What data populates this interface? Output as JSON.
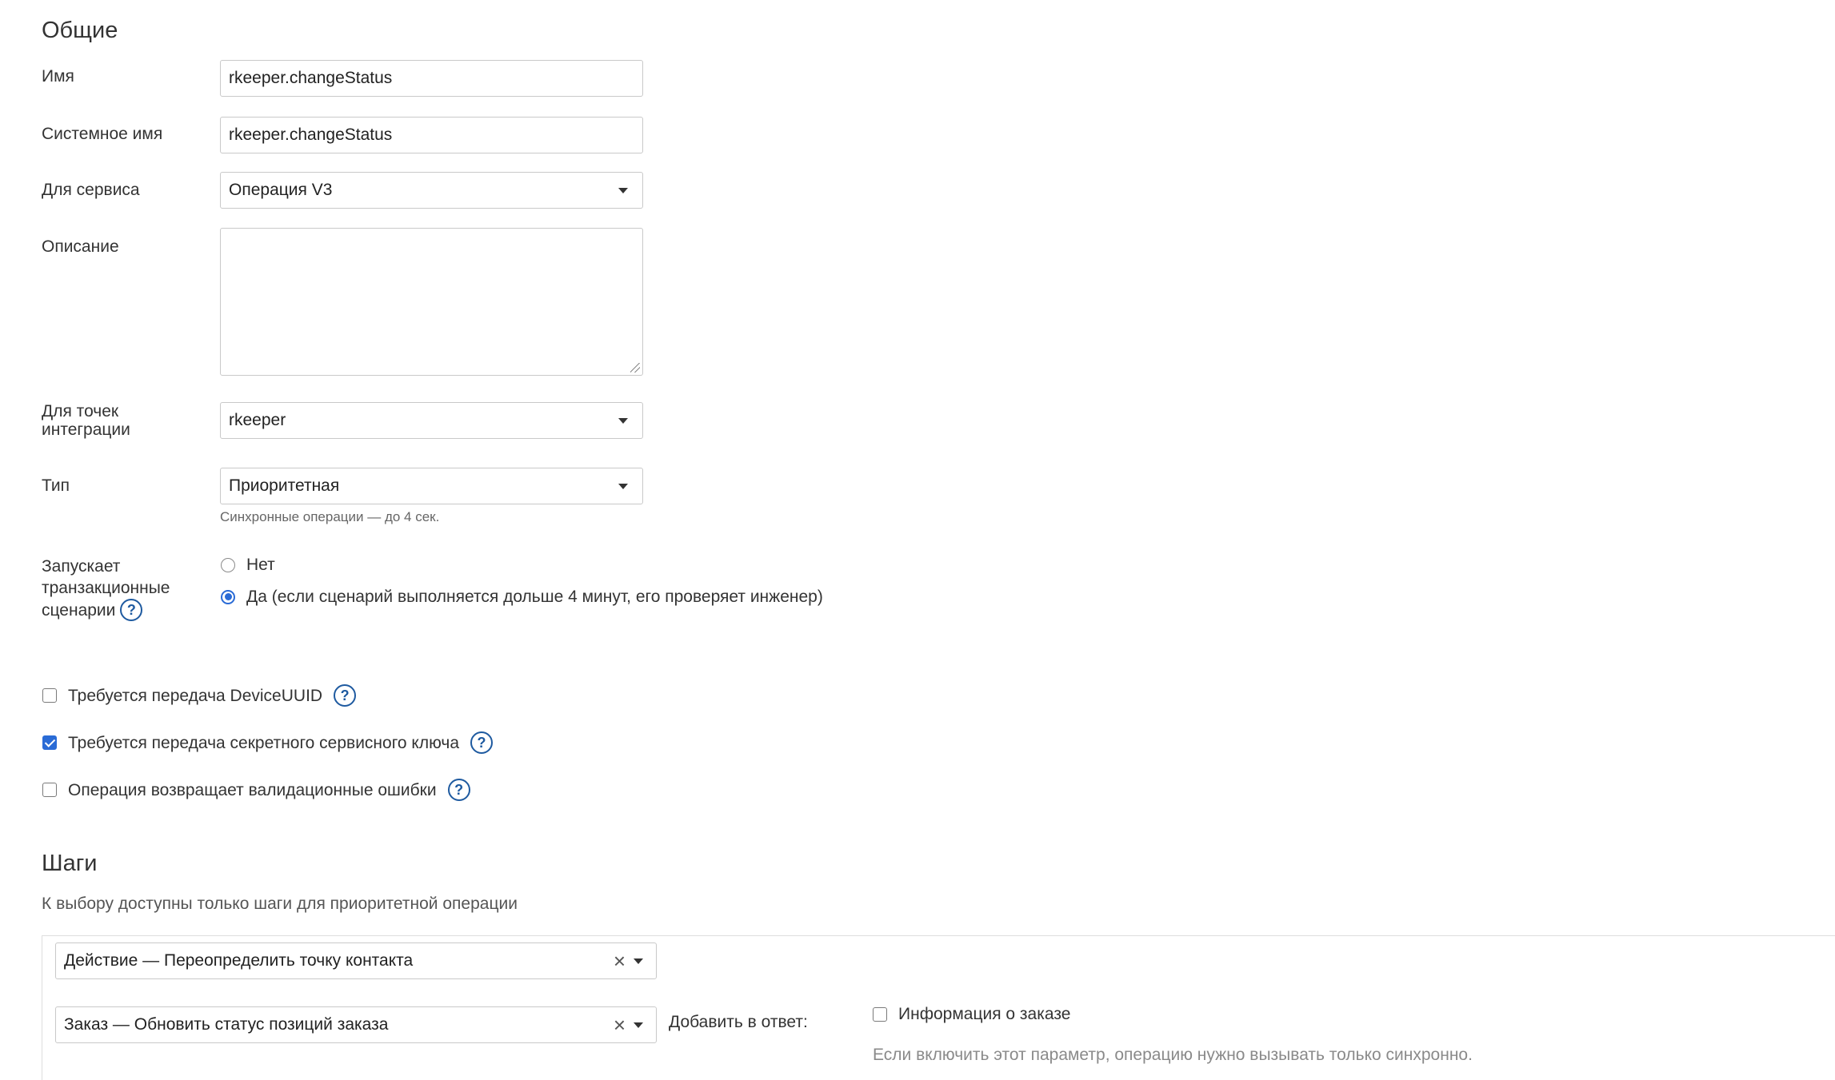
{
  "general": {
    "heading": "Общие",
    "name_label": "Имя",
    "name_value": "rkeeper.changeStatus",
    "sysname_label": "Системное имя",
    "sysname_value": "rkeeper.changeStatus",
    "service_label": "Для сервиса",
    "service_value": "Операция V3",
    "description_label": "Описание",
    "description_value": "",
    "integration_label_1": "Для точек",
    "integration_label_2": "интеграции",
    "integration_value": "rkeeper",
    "type_label": "Тип",
    "type_value": "Приоритетная",
    "type_hint": "Синхронные операции — до 4 сек.",
    "tx_label_1": "Запускает",
    "tx_label_2": "транзакционные",
    "tx_label_3": "сценарии",
    "tx_options": [
      {
        "label": "Нет",
        "selected": false
      },
      {
        "label": "Да (если сценарий выполняется дольше 4 минут, его проверяет инженер)",
        "selected": true
      }
    ],
    "help_glyph": "?"
  },
  "options": [
    {
      "label": "Требуется передача DeviceUUID",
      "checked": false
    },
    {
      "label": "Требуется передача секретного сервисного ключа",
      "checked": true
    },
    {
      "label": "Операция возвращает валидационные ошибки",
      "checked": false
    }
  ],
  "steps": {
    "heading": "Шаги",
    "subtitle": "К выбору доступны только шаги для приоритетной операции",
    "step1": "Действие — Переопределить точку контакта",
    "step2": "Заказ — Обновить статус позиций заказа",
    "clear_glyph": "×",
    "add_to_response_label": "Добавить в ответ:",
    "order_info_label": "Информация о заказе",
    "order_info_checked": false,
    "order_info_hint": "Если включить этот параметр, операцию нужно вызывать только синхронно."
  },
  "colors": {
    "accent": "#2a6bd6",
    "help_icon": "#1e5aa0",
    "border": "#c9c9c9"
  }
}
